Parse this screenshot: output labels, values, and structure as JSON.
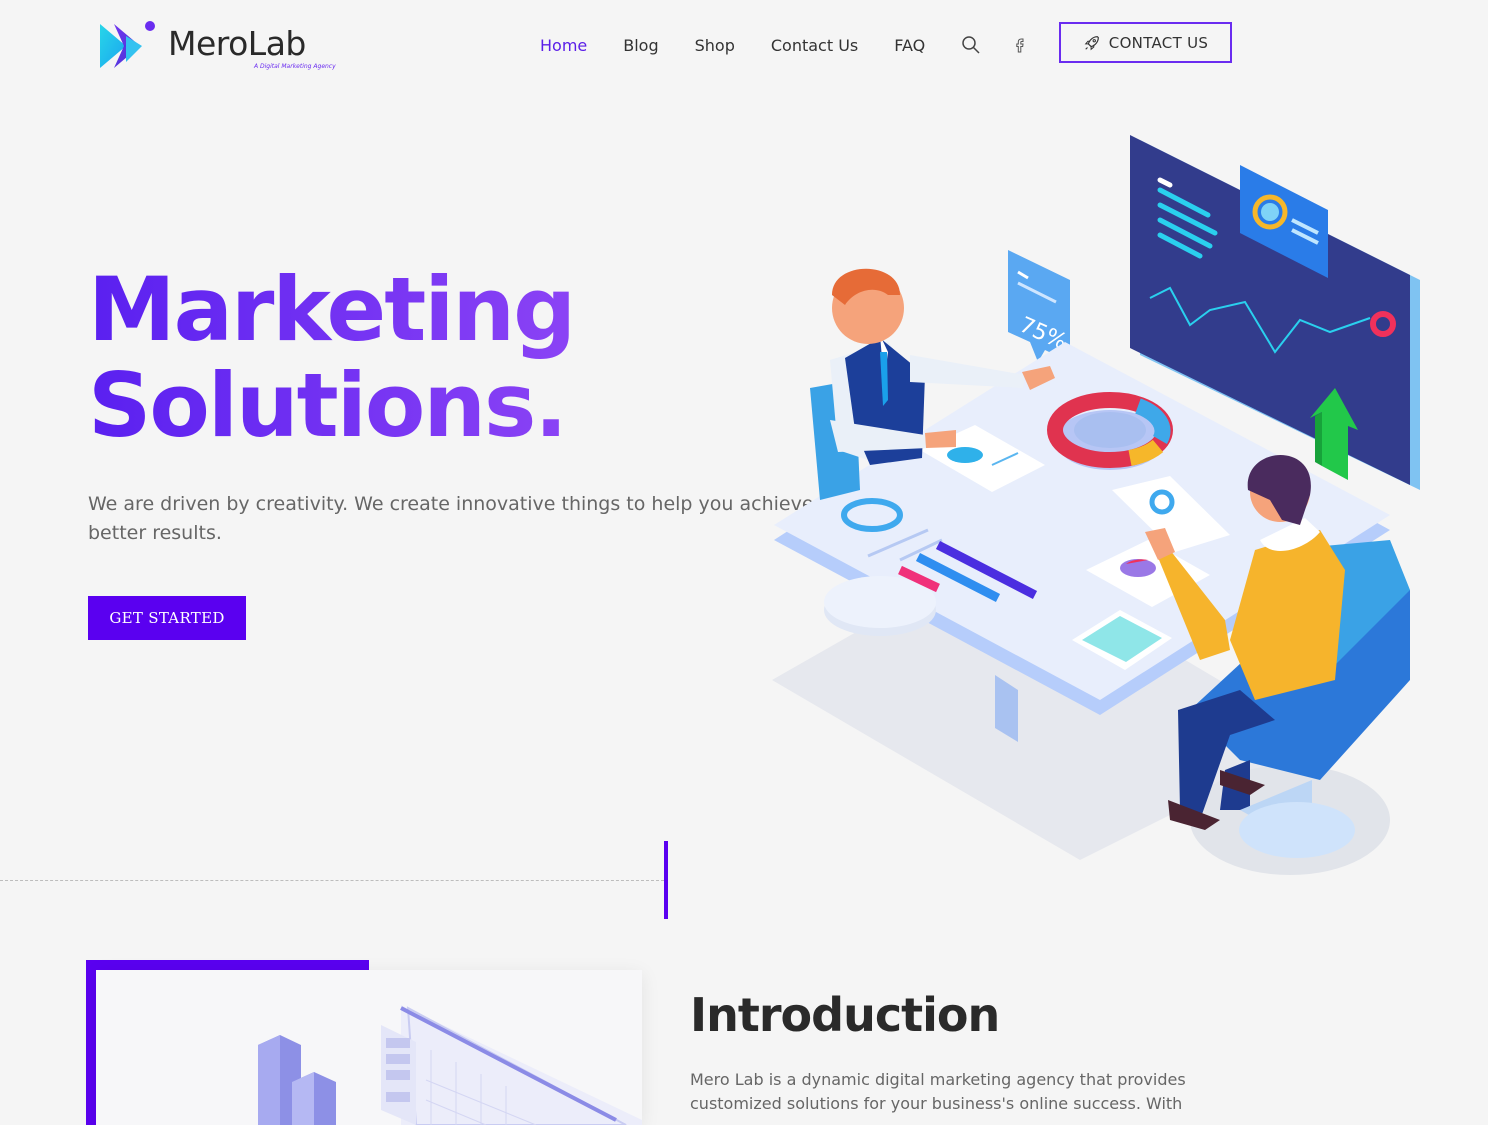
{
  "header": {
    "logo_text": "MeroLab",
    "logo_tagline": "A Digital Marketing Agency",
    "nav": [
      {
        "label": "Home",
        "active": true
      },
      {
        "label": "Blog"
      },
      {
        "label": "Shop"
      },
      {
        "label": "Contact Us"
      },
      {
        "label": "FAQ"
      }
    ],
    "icons": [
      "search-icon",
      "facebook-icon",
      "rocket-icon"
    ],
    "cta_label": "CONTACT US"
  },
  "hero": {
    "title_line1": "Marketing",
    "title_line2": "Solutions.",
    "text": "We are driven by creativity. We create innovative things to help you achieve better results.",
    "button_label": "GET STARTED",
    "badge_text": "75%"
  },
  "intro": {
    "title": "Introduction",
    "text": "Mero Lab is a dynamic digital marketing agency that provides customized solutions for your business's online success. With"
  },
  "colors": {
    "accent": "#5a00f0",
    "title_gradient_start": "#5a20f0",
    "title_gradient_end": "#8b43f5",
    "background": "#f5f5f5"
  }
}
